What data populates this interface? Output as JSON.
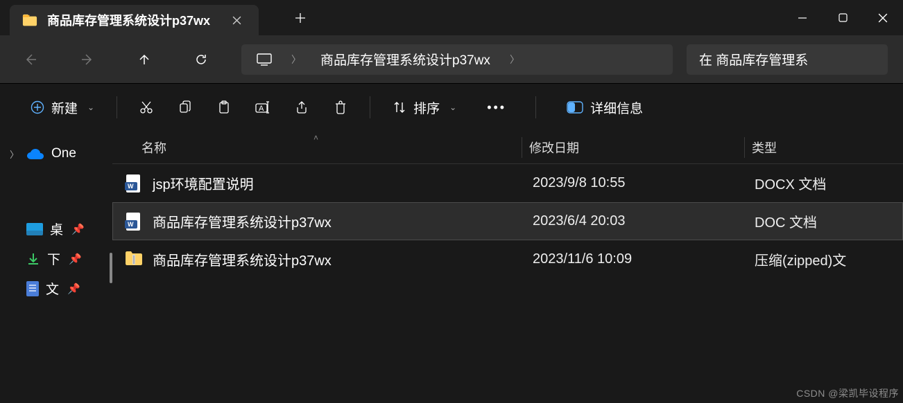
{
  "tab": {
    "title": "商品库存管理系统设计p37wx"
  },
  "breadcrumb": {
    "current": "商品库存管理系统设计p37wx"
  },
  "search": {
    "placeholder": "在 商品库存管理系"
  },
  "toolbar": {
    "new": "新建",
    "sort": "排序",
    "details": "详细信息"
  },
  "sidebar": {
    "onedrive": "One",
    "desktop": "桌",
    "downloads": "下",
    "documents": "文"
  },
  "columns": {
    "name": "名称",
    "date": "修改日期",
    "type": "类型"
  },
  "files": [
    {
      "name": "jsp环境配置说明",
      "date": "2023/9/8 10:55",
      "type": "DOCX 文档",
      "icon": "docx"
    },
    {
      "name": "商品库存管理系统设计p37wx",
      "date": "2023/6/4 20:03",
      "type": "DOC 文档",
      "icon": "doc",
      "selected": true
    },
    {
      "name": "商品库存管理系统设计p37wx",
      "date": "2023/11/6 10:09",
      "type": "压缩(zipped)文",
      "icon": "zip"
    }
  ],
  "watermark": "CSDN @梁凯毕设程序"
}
